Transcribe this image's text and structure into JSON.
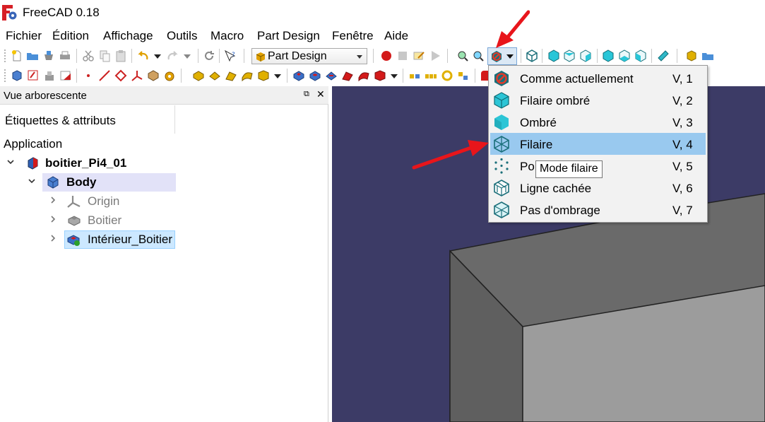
{
  "window": {
    "title": "FreeCAD 0.18"
  },
  "menubar": [
    "Fichier",
    "Édition",
    "Affichage",
    "Outils",
    "Macro",
    "Part Design",
    "Fenêtre",
    "Aide"
  ],
  "toolbar": {
    "workbench": "Part Design",
    "draw_style_button": "draw-style"
  },
  "tree_panel": {
    "title": "Vue arborescente",
    "float_glyph": "⧉",
    "close_glyph": "✕",
    "header_label": "Étiquettes & attributs",
    "root_label": "Application",
    "items": [
      {
        "label": "boitier_Pi4_01",
        "bold": true,
        "icon": "part-document-icon",
        "expanded": true
      },
      {
        "label": "Body",
        "bold": true,
        "icon": "body-icon",
        "expanded": true,
        "highlighted": true
      },
      {
        "label": "Origin",
        "dimmed": true,
        "icon": "origin-axes-icon",
        "expanded": false
      },
      {
        "label": "Boitier",
        "dimmed": true,
        "icon": "pad-feature-icon",
        "expanded": false
      },
      {
        "label": "Intérieur_Boitier",
        "selected": true,
        "icon": "pocket-feature-icon",
        "expanded": false
      }
    ]
  },
  "draw_style_menu": {
    "items": [
      {
        "label": "Comme actuellement",
        "shortcut": "V, 1",
        "icon": "as-is-icon"
      },
      {
        "label": "Filaire ombré",
        "shortcut": "V, 2",
        "icon": "flat-lines-icon"
      },
      {
        "label": "Ombré",
        "shortcut": "V, 3",
        "icon": "shaded-icon"
      },
      {
        "label": "Filaire",
        "shortcut": "V, 4",
        "icon": "wireframe-icon",
        "active": true
      },
      {
        "label": "Po",
        "shortcut": "V, 5",
        "icon": "points-icon"
      },
      {
        "label": "Ligne cachée",
        "shortcut": "V, 6",
        "icon": "hidden-line-icon"
      },
      {
        "label": "Pas d'ombrage",
        "shortcut": "V, 7",
        "icon": "no-shading-icon"
      }
    ]
  },
  "tooltip": {
    "text": "Mode filaire"
  },
  "colors": {
    "viewport_background": "#3c3b66",
    "box_face_dark": "#6a6a6a",
    "box_face_light": "#9c9c9c",
    "menu_highlight": "#99c9ef",
    "annotation_arrow": "#e8151b"
  }
}
